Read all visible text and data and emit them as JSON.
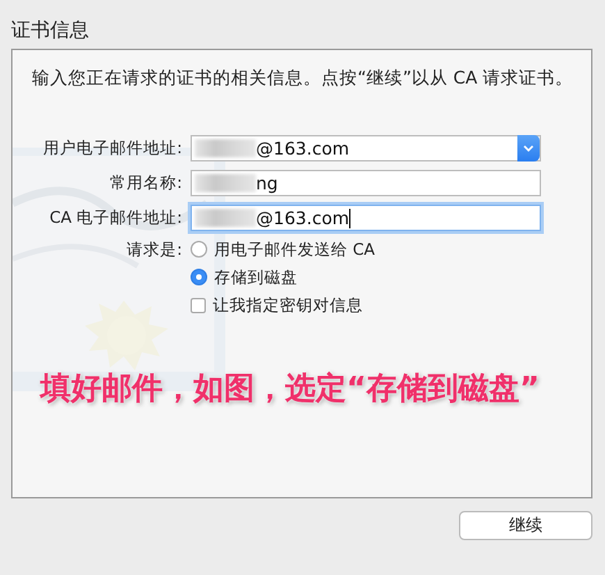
{
  "section_title": "证书信息",
  "description": "输入您正在请求的证书的相关信息。点按“继续”以从 CA 请求证书。",
  "fields": [
    {
      "kind": "dropdown",
      "label": "用户电子邮件地址:",
      "value": "@163.com",
      "redacted": true,
      "focused": false
    },
    {
      "kind": "text",
      "label": "常用名称:",
      "value": "ng",
      "redacted": true,
      "focused": false
    },
    {
      "kind": "text",
      "label": "CA 电子邮件地址:",
      "value": "@163.com",
      "redacted": true,
      "focused": true
    }
  ],
  "request": {
    "label": "请求是:",
    "options": [
      {
        "kind": "radio",
        "label": "用电子邮件发送给 CA",
        "selected": false
      },
      {
        "kind": "radio",
        "label": "存储到磁盘",
        "selected": true
      },
      {
        "kind": "checkbox",
        "label": "让我指定密钥对信息",
        "checked": false
      }
    ]
  },
  "annotation": "填好邮件，如图，选定“存储到磁盘”",
  "buttons": [
    "继续"
  ]
}
